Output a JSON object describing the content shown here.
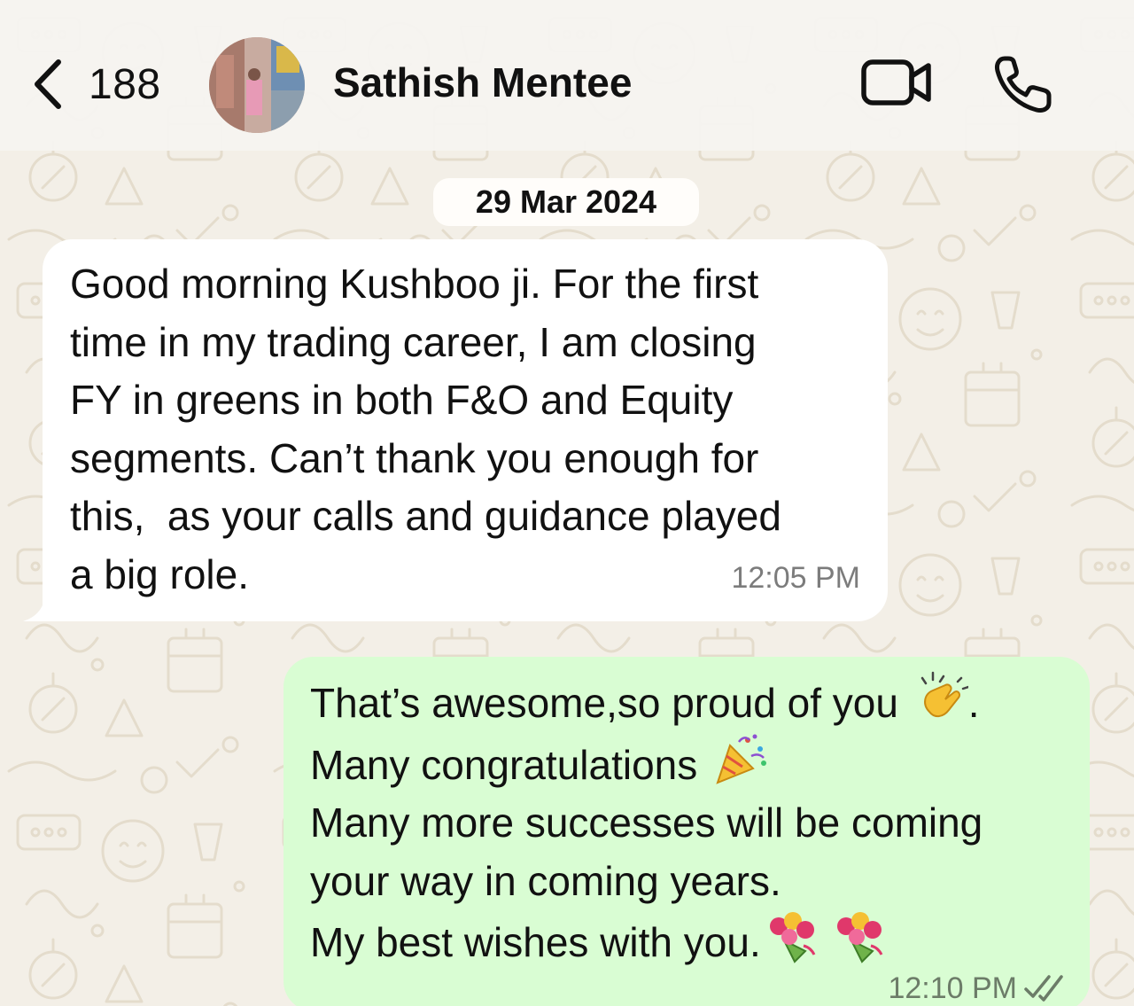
{
  "header": {
    "back_count": "188",
    "contact_name": "Sathish Mentee",
    "icons": [
      "chevron-left-icon",
      "video-camera-icon",
      "phone-icon"
    ]
  },
  "date_separator": "29 Mar 2024",
  "messages": [
    {
      "direction": "incoming",
      "lines": [
        "Good morning Kushboo ji. For the first",
        "time in my trading career, I am closing",
        "FY in greens in both F&O and Equity",
        "segments. Can’t thank you enough for",
        "this,  as your calls and guidance played",
        "a big role."
      ],
      "time": "12:05 PM"
    },
    {
      "direction": "outgoing",
      "lines": [
        "That’s awesome,so proud of you",
        ".",
        "Many congratulations",
        "Many more successes will be coming",
        "your way in coming years.",
        "My best wishes with you."
      ],
      "emojis": [
        "clapping-hands-icon",
        "party-popper-icon",
        "bouquet-icon",
        "bouquet-icon"
      ],
      "time": "12:10 PM",
      "status": "read-double-tick-icon"
    }
  ],
  "colors": {
    "background": "#f3efe7",
    "incoming_bubble": "#ffffff",
    "outgoing_bubble": "#d9fdd3",
    "tick": "#6c7c68"
  }
}
